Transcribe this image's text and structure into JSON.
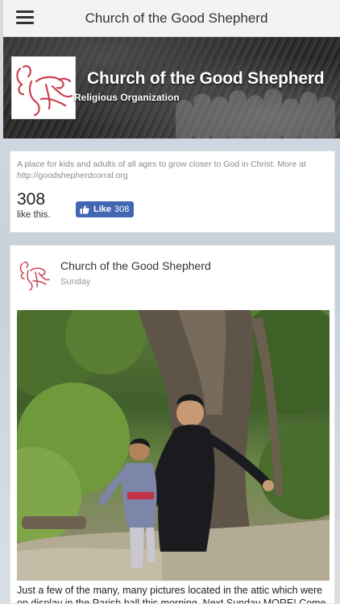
{
  "app_bar": {
    "title": "Church of the Good Shepherd",
    "menu_icon": "hamburger-menu-icon"
  },
  "cover": {
    "page_name": "Church of the Good Shepherd",
    "category": "Religious Organization",
    "logo_icon": "good-shepherd-logo",
    "colors": {
      "logo": "#c9424f"
    }
  },
  "about": {
    "description": "A place for kids and adults of all ages to grow closer to God in Christ. More at http://goodshepherdcorral.org",
    "like_count": "308",
    "like_label": "like this.",
    "like_button": {
      "label": "Like",
      "count": "308",
      "icon": "thumbs-up-icon",
      "color": "#4267b2"
    }
  },
  "post": {
    "author": "Church of the Good Shepherd",
    "time": "Sunday",
    "text": "Just a few of the many, many pictures located in the attic which were on display in the Parish hall this morning. Next Sunday MORE! Come help..."
  }
}
